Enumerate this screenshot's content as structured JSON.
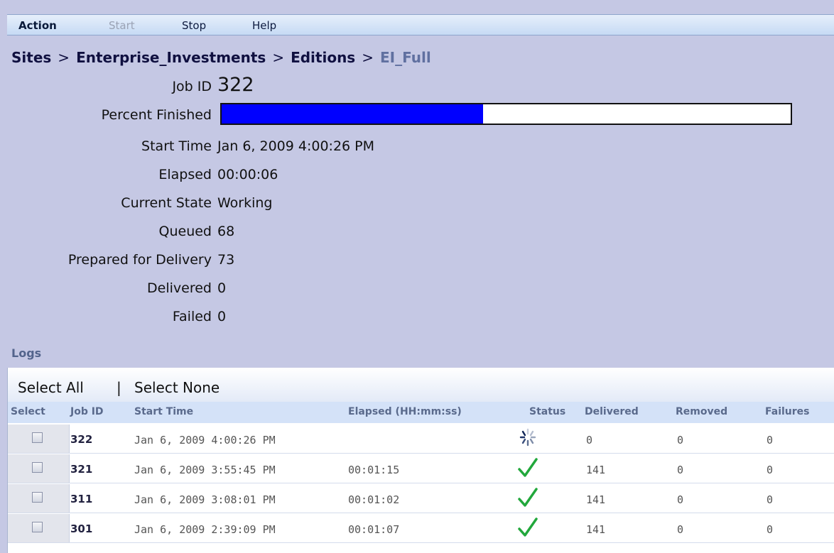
{
  "menu": {
    "action": "Action",
    "start": "Start",
    "stop": "Stop",
    "help": "Help"
  },
  "breadcrumb": {
    "sites": "Sites",
    "site": "Enterprise_Investments",
    "editions": "Editions",
    "current": "EI_Full",
    "separator": ">"
  },
  "job": {
    "job_id_label": "Job ID",
    "job_id": "322",
    "percent_label": "Percent Finished",
    "percent_fraction": 0.46,
    "start_label": "Start Time",
    "start": "Jan 6, 2009 4:00:26 PM",
    "elapsed_label": "Elapsed",
    "elapsed": "00:00:06",
    "state_label": "Current State",
    "state": "Working",
    "queued_label": "Queued",
    "queued": "68",
    "prepared_label": "Prepared for Delivery",
    "prepared": "73",
    "delivered_label": "Delivered",
    "delivered": "0",
    "failed_label": "Failed",
    "failed": "0"
  },
  "logs": {
    "title": "Logs",
    "select_all": "Select All",
    "divider": "|",
    "select_none": "Select None",
    "columns": [
      "Select",
      "Job ID",
      "Start Time",
      "Elapsed (HH:mm:ss)",
      "Status",
      "Delivered",
      "Removed",
      "Failures"
    ],
    "rows": [
      {
        "job_id": "322",
        "start": "Jan 6, 2009 4:00:26 PM",
        "elapsed": "",
        "status": "spinner-icon",
        "delivered": "0",
        "removed": "0",
        "failures": "0"
      },
      {
        "job_id": "321",
        "start": "Jan 6, 2009 3:55:45 PM",
        "elapsed": "00:01:15",
        "status": "checkmark-icon",
        "delivered": "141",
        "removed": "0",
        "failures": "0"
      },
      {
        "job_id": "311",
        "start": "Jan 6, 2009 3:08:01 PM",
        "elapsed": "00:01:02",
        "status": "checkmark-icon",
        "delivered": "141",
        "removed": "0",
        "failures": "0"
      },
      {
        "job_id": "301",
        "start": "Jan 6, 2009 2:39:09 PM",
        "elapsed": "00:01:07",
        "status": "checkmark-icon",
        "delivered": "141",
        "removed": "0",
        "failures": "0"
      }
    ]
  },
  "colors": {
    "background": "#c5c8e4",
    "progress_fill": "#0000ff",
    "check_green": "#22a83c"
  }
}
